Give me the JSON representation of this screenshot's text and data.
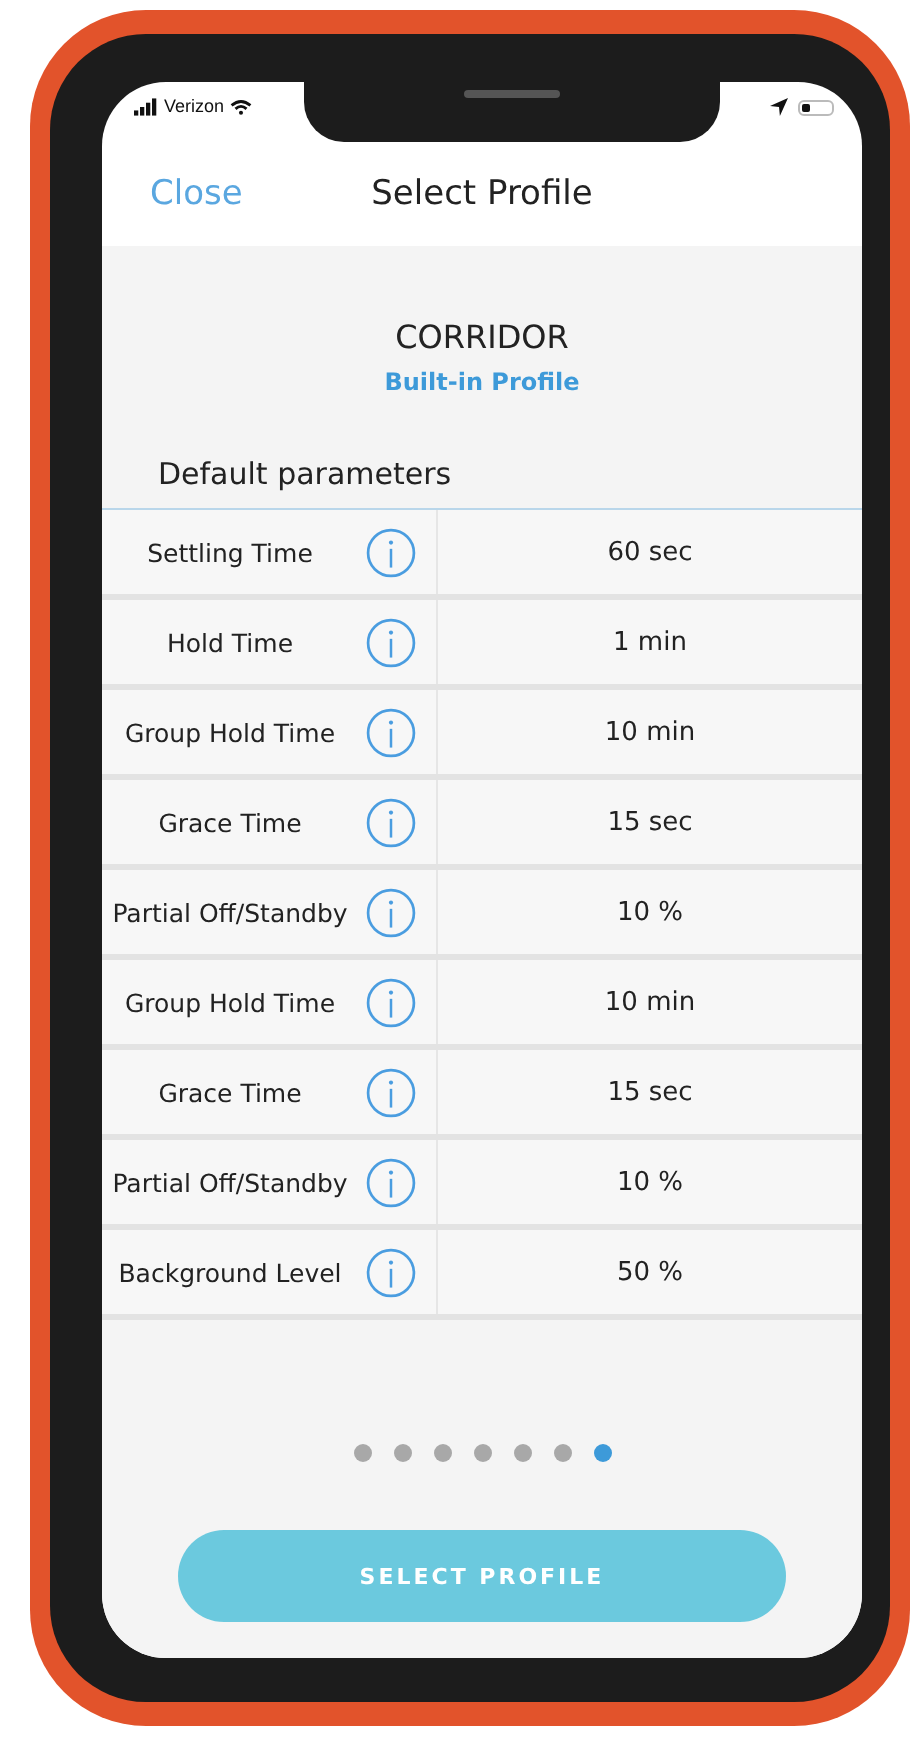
{
  "status_bar": {
    "carrier": "Verizon"
  },
  "nav": {
    "close": "Close",
    "title": "Select Profile"
  },
  "profile": {
    "name": "CORRIDOR",
    "type": "Built-in Profile"
  },
  "section_title": "Default parameters",
  "parameters": [
    {
      "label": "Settling Time",
      "value": "60 sec"
    },
    {
      "label": "Hold Time",
      "value": "1 min"
    },
    {
      "label": "Group Hold Time",
      "value": "10 min"
    },
    {
      "label": "Grace Time",
      "value": "15 sec"
    },
    {
      "label": "Partial Off/Standby",
      "value": "10 %"
    },
    {
      "label": "Group Hold Time",
      "value": "10 min"
    },
    {
      "label": "Grace Time",
      "value": "15 sec"
    },
    {
      "label": "Partial Off/Standby",
      "value": "10 %"
    },
    {
      "label": "Background Level",
      "value": "50 %"
    }
  ],
  "pages": [
    {
      "selected": false
    },
    {
      "selected": false
    },
    {
      "selected": false
    },
    {
      "selected": false
    },
    {
      "selected": false
    },
    {
      "selected": false
    },
    {
      "selected": true
    }
  ],
  "button": "SELECT PROFILE"
}
